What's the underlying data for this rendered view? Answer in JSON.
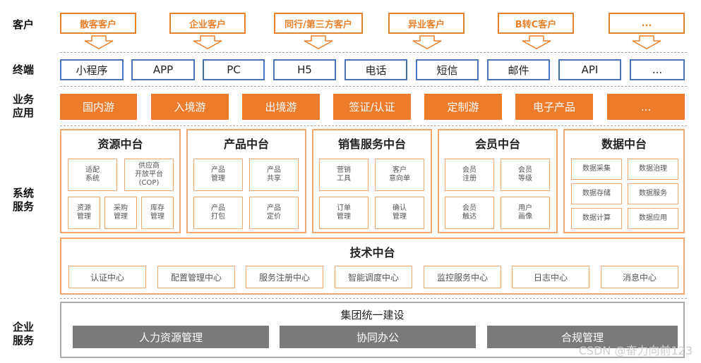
{
  "row_labels": {
    "customer": "客户",
    "terminal": "终端",
    "business": "业务\n应用",
    "system": "系统\n服务",
    "enterprise": "企业\n服务"
  },
  "customers": [
    "散客客户",
    "企业客户",
    "同行/第三方客户",
    "异业客户",
    "B转C客户",
    "..."
  ],
  "terminals": [
    "小程序",
    "APP",
    "PC",
    "H5",
    "电话",
    "短信",
    "邮件",
    "API",
    "..."
  ],
  "business_apps": [
    "国内游",
    "入境游",
    "出境游",
    "签证/认证",
    "定制游",
    "电子产品",
    "..."
  ],
  "platforms": [
    {
      "title": "资源中台",
      "cells": [
        "适配\n系统",
        "供应商\n开放平台\n(COP)",
        "资源\n管理",
        "采购\n管理",
        "库存\n管理"
      ]
    },
    {
      "title": "产品中台",
      "cells": [
        "产品\n管理",
        "产品\n共享",
        "产品\n打包",
        "产品\n定价"
      ]
    },
    {
      "title": "销售服务中台",
      "cells": [
        "营销\n工具",
        "客户\n意向单",
        "订单\n管理",
        "确认\n管理"
      ]
    },
    {
      "title": "会员中台",
      "cells": [
        "会员\n注册",
        "会员\n等级",
        "会员\n触达",
        "用户\n画像"
      ]
    },
    {
      "title": "数据中台",
      "cells": [
        "数据采集",
        "数据治理",
        "数据存储",
        "数据服务",
        "数据计算",
        "数据应用"
      ]
    }
  ],
  "tech_platform": {
    "title": "技术中台",
    "items": [
      "认证中心",
      "配置管理中心",
      "服务注册中心",
      "智能调度中心",
      "监控服务中心",
      "日志中心",
      "消息中心"
    ]
  },
  "enterprise": {
    "title": "集团统一建设",
    "items": [
      "人力资源管理",
      "协同办公",
      "合规管理"
    ]
  },
  "watermark": "CSDN @奋力向前123",
  "colors": {
    "orange": "#ec7c2c",
    "orange_light": "#f0a870",
    "blue": "#4a73b8",
    "gray": "#7a7a7a"
  }
}
